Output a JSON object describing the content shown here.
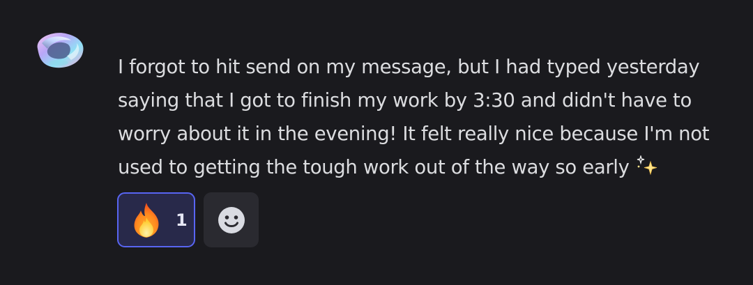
{
  "message": {
    "text": "I forgot to hit send on my message, but I had typed yesterday saying that I got to finish my work by 3:30 and didn't have to worry about it in the evening! It felt really nice because I'm not used to getting the tough work out of the way so early",
    "trailing_emoji": "sparkles-icon"
  },
  "reactions": [
    {
      "emoji": "fire-icon",
      "count": "1",
      "selected": true
    }
  ],
  "add_reaction": {
    "icon": "smiley-icon"
  },
  "colors": {
    "background": "#1a1a1e",
    "text": "#dcdde0",
    "reaction_selected_bg": "#28294a",
    "reaction_selected_border": "#5865f2",
    "add_reaction_bg": "#2a2a30"
  }
}
